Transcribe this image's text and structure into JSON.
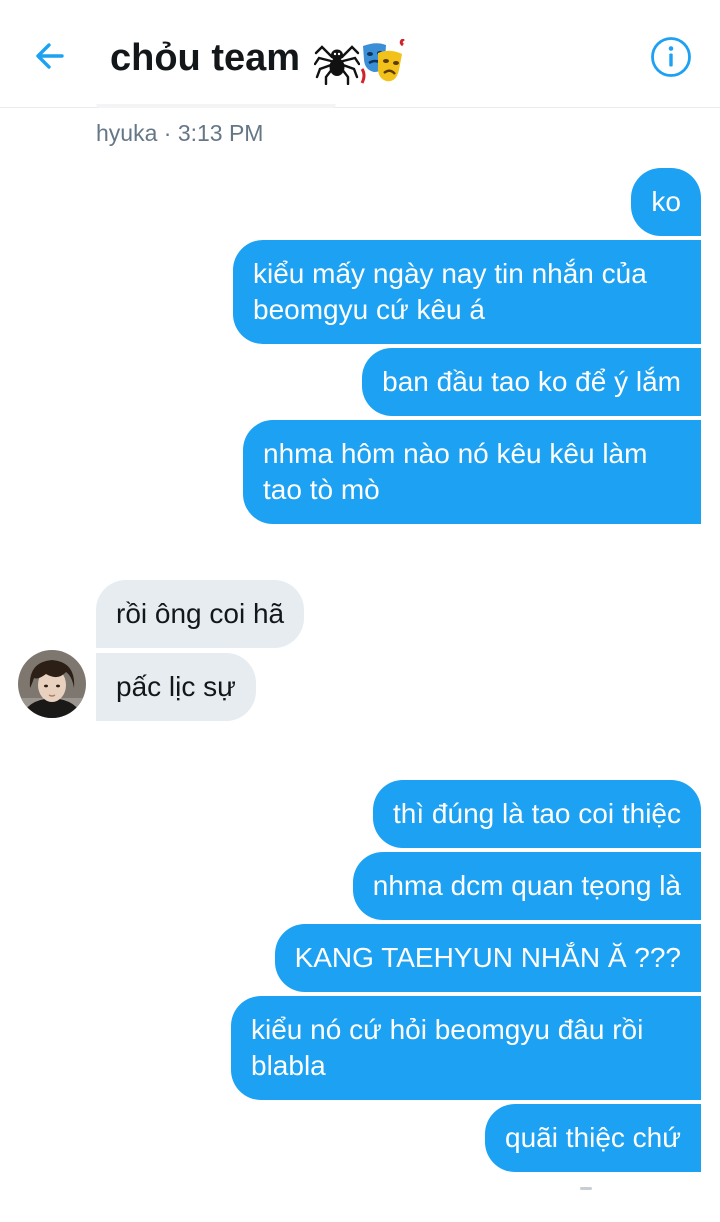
{
  "header": {
    "title": "chỏu team",
    "back_icon": "arrow-left-icon",
    "info_icon": "info-icon",
    "title_emoji": [
      "spider-icon",
      "performing-arts-icon"
    ]
  },
  "meta": {
    "sender_time": "hyuka · 3:13 PM"
  },
  "messages": [
    {
      "direction": "out",
      "text": "ko"
    },
    {
      "direction": "out",
      "lines": [
        "kiểu mấy ngày nay tin nhắn của",
        "beomgyu cứ kêu á"
      ]
    },
    {
      "direction": "out",
      "text": "ban đầu tao ko để ý lắm"
    },
    {
      "direction": "out",
      "lines": [
        "nhma hôm nào nó kêu kêu làm",
        "tao tò mò"
      ]
    },
    {
      "direction": "in",
      "text": "rồi ông coi hã"
    },
    {
      "direction": "in",
      "text": "pấc lịc sự"
    },
    {
      "direction": "out",
      "text": "thì đúng là tao coi thiệc"
    },
    {
      "direction": "out",
      "text": "nhma dcm quan tẹong là"
    },
    {
      "direction": "out",
      "text": "KANG TAEHYUN NHẮN Ă ???"
    },
    {
      "direction": "out",
      "lines": [
        "kiểu nó cứ hỏi beomgyu đâu rồi",
        "blabla"
      ]
    },
    {
      "direction": "out",
      "text": "quãi thiệc chứ"
    }
  ],
  "colors": {
    "accent": "#1da1f2",
    "incoming_bubble": "#e6ecf0",
    "meta_text": "#657786",
    "title_text": "#14171a"
  }
}
